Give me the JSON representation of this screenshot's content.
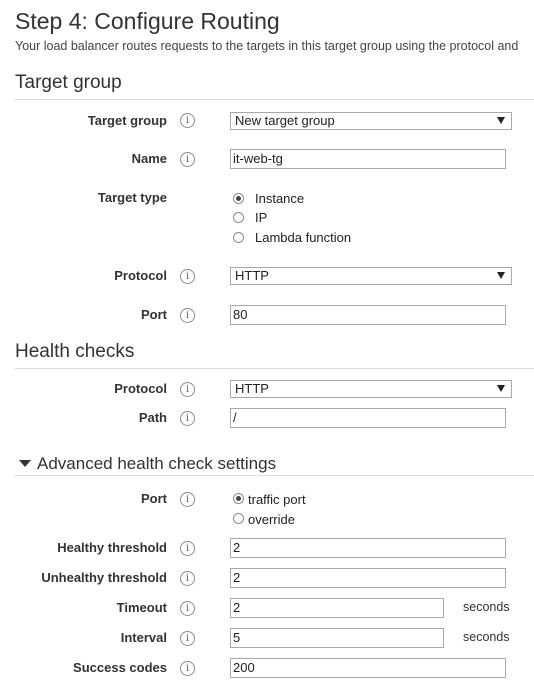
{
  "header": {
    "title": "Step 4: Configure Routing",
    "description": "Your load balancer routes requests to the targets in this target group using the protocol and"
  },
  "target_group_section": {
    "title": "Target group",
    "fields": {
      "target_group": {
        "label": "Target group",
        "value": "New target group"
      },
      "name": {
        "label": "Name",
        "value": "it-web-tg"
      },
      "target_type": {
        "label": "Target type",
        "options": [
          "Instance",
          "IP",
          "Lambda function"
        ],
        "selected": "Instance"
      },
      "protocol": {
        "label": "Protocol",
        "value": "HTTP"
      },
      "port": {
        "label": "Port",
        "value": "80"
      }
    }
  },
  "health_checks_section": {
    "title": "Health checks",
    "fields": {
      "protocol": {
        "label": "Protocol",
        "value": "HTTP"
      },
      "path": {
        "label": "Path",
        "value": "/"
      }
    }
  },
  "advanced_section": {
    "title": "Advanced health check settings",
    "expanded": true,
    "fields": {
      "port": {
        "label": "Port",
        "options": [
          "traffic port",
          "override"
        ],
        "selected": "traffic port"
      },
      "healthy_threshold": {
        "label": "Healthy threshold",
        "value": "2"
      },
      "unhealthy_threshold": {
        "label": "Unhealthy threshold",
        "value": "2"
      },
      "timeout": {
        "label": "Timeout",
        "value": "2",
        "unit": "seconds"
      },
      "interval": {
        "label": "Interval",
        "value": "5",
        "unit": "seconds"
      },
      "success_codes": {
        "label": "Success codes",
        "value": "200"
      }
    }
  },
  "icons": {
    "info": "info-icon",
    "select_arrow": "chevron-down-icon",
    "collapse_toggle": "caret-down-icon"
  },
  "info_glyph": "i"
}
